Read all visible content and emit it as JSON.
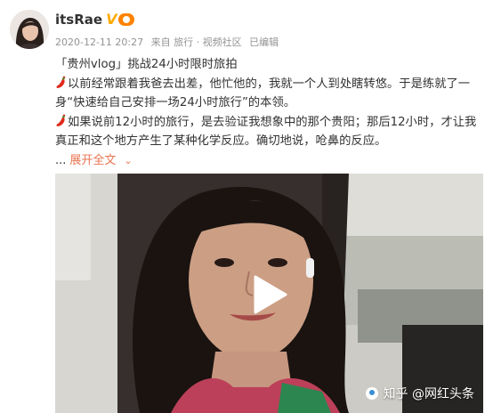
{
  "post": {
    "author": "itsRae",
    "verified_mark": "V",
    "timestamp": "2020-12-11 20:27",
    "source": "来自 旅行 · 视频社区",
    "edited": "已编辑",
    "title_line": "「贵州vlog」挑战24小时限时旅拍",
    "paragraph1": "以前经常跟着我爸去出差，他忙他的，我就一个人到处瞎转悠。于是练就了一身“快速给自己安排一场24小时旅行”的本领。",
    "paragraph2": "如果说前12小时的旅行，是去验证我想象中的那个贵阳；那后12小时，才让我真正和这个地方产生了某种化学反应。确切地说，呛鼻的反应。",
    "expand_dots": "...",
    "expand_label": "展开全文",
    "expand_chevron": "⌄"
  },
  "video": {
    "watermark_text": "知乎 @网红头条"
  },
  "colors": {
    "accent_orange": "#eb7350",
    "verified_gold": "#ffab02",
    "meta_gray": "#939393"
  },
  "icons": [
    "avatar",
    "verified-icon",
    "level-badge-icon",
    "chili-pepper-icon",
    "chevron-down-icon",
    "play-icon",
    "zhihu-watermark-icon"
  ]
}
